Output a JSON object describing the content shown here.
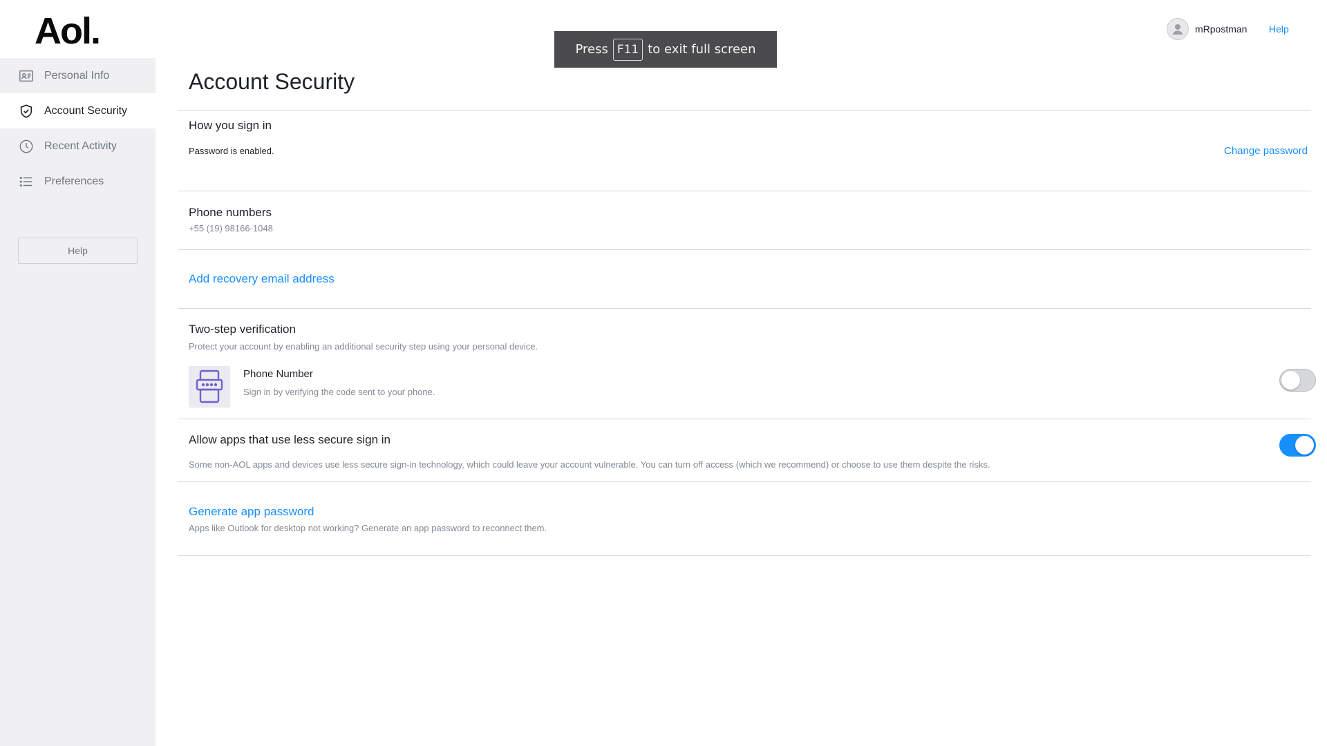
{
  "sidebar": {
    "logo": "Aol.",
    "items": [
      {
        "label": "Personal Info",
        "icon": "id-card-icon"
      },
      {
        "label": "Account Security",
        "icon": "shield-icon",
        "active": true
      },
      {
        "label": "Recent Activity",
        "icon": "clock-icon"
      },
      {
        "label": "Preferences",
        "icon": "list-icon"
      }
    ],
    "help_label": "Help"
  },
  "topbar": {
    "username": "mRpostman",
    "help_label": "Help"
  },
  "fullscreen_banner": {
    "press": "Press",
    "key": "F11",
    "rest": "to exit full screen"
  },
  "page": {
    "title": "Account Security"
  },
  "sign_in": {
    "heading": "How you sign in",
    "status": "Password is enabled.",
    "change_password": "Change password"
  },
  "phone_numbers": {
    "heading": "Phone numbers",
    "number": "+55 (19) 98166-1048"
  },
  "recovery": {
    "link": "Add recovery email address"
  },
  "two_step": {
    "heading": "Two-step verification",
    "description": "Protect your account by enabling an additional security step using your personal device.",
    "method_title": "Phone Number",
    "method_description": "Sign in by verifying the code sent to your phone.",
    "enabled": false
  },
  "less_secure": {
    "heading": "Allow apps that use less secure sign in",
    "description": "Some non-AOL apps and devices use less secure sign-in technology, which could leave your account vulnerable. You can turn off access (which we recommend) or choose to use them despite the risks.",
    "enabled": true
  },
  "app_password": {
    "link": "Generate app password",
    "description": "Apps like Outlook for desktop not working? Generate an app password to reconnect them."
  },
  "colors": {
    "accent": "#188fff",
    "sidebar_bg": "#f0f0f3",
    "banner_bg": "#4b4b4d"
  }
}
